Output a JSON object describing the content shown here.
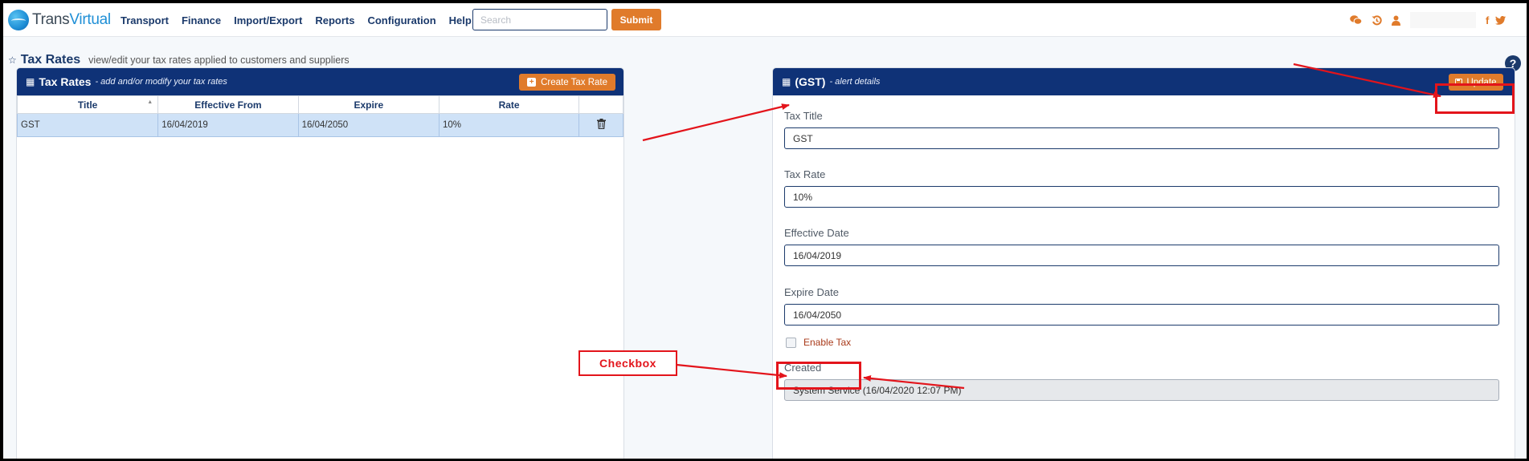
{
  "brand": {
    "part1": "Trans",
    "part2": "Virtual"
  },
  "nav": {
    "items": [
      "Transport",
      "Finance",
      "Import/Export",
      "Reports",
      "Configuration",
      "Help"
    ]
  },
  "search": {
    "placeholder": "Search",
    "submit_label": "Submit"
  },
  "page": {
    "title": "Tax Rates",
    "subtitle": "view/edit your tax rates applied to customers and suppliers"
  },
  "list_panel": {
    "title": "Tax Rates",
    "subtitle": "- add and/or modify your tax rates",
    "create_label": "Create Tax Rate",
    "columns": [
      "Title",
      "Effective From",
      "Expire",
      "Rate"
    ],
    "rows": [
      {
        "title": "GST",
        "effective_from": "16/04/2019",
        "expire": "16/04/2050",
        "rate": "10%"
      }
    ]
  },
  "detail_panel": {
    "title": "(GST)",
    "subtitle": "- alert details",
    "update_label": "Update",
    "fields": {
      "tax_title": {
        "label": "Tax Title",
        "value": "GST"
      },
      "tax_rate": {
        "label": "Tax Rate",
        "value": "10%"
      },
      "effective_date": {
        "label": "Effective Date",
        "value": "16/04/2019"
      },
      "expire_date": {
        "label": "Expire Date",
        "value": "16/04/2050"
      },
      "enable_tax": {
        "label": "Enable Tax",
        "checked": false
      },
      "created": {
        "label": "Created",
        "value": "System Service (16/04/2020 12:07 PM)"
      }
    }
  },
  "annotation": {
    "callout_label": "Checkbox",
    "color": "#e3141b"
  },
  "colors": {
    "primary": "#0f3277",
    "accent": "#e07b2b",
    "selected_row": "#cfe2f7"
  },
  "icons": {
    "nav_right": [
      "chat-icon",
      "history-icon",
      "user-icon",
      "facebook-icon",
      "twitter-icon"
    ],
    "social": {
      "facebook": "f",
      "twitter": "t"
    }
  }
}
